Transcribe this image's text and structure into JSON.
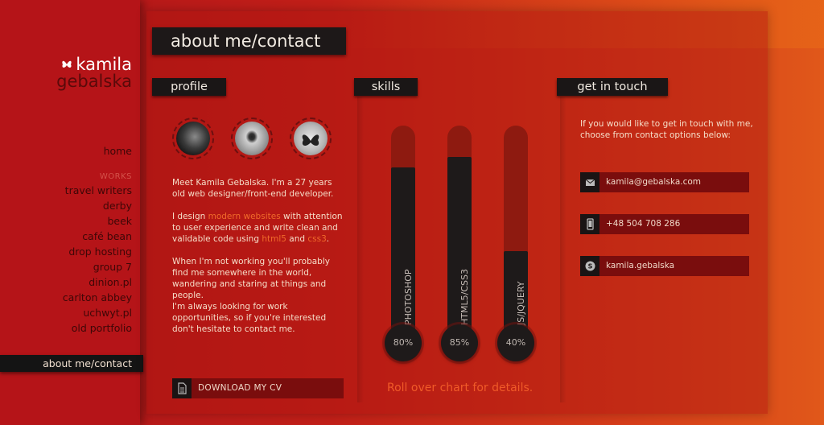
{
  "logo": {
    "line1": "kamila",
    "line2": "gebalska"
  },
  "nav": {
    "home": "home",
    "works_heading": "WORKS",
    "items": [
      "travel writers",
      "derby",
      "beek",
      "café bean",
      "drop hosting",
      "group 7",
      "dinion.pl",
      "carlton abbey",
      "uchwyt.pl",
      "old portfolio"
    ],
    "active": "about me/contact"
  },
  "page_title": "about me/contact",
  "profile": {
    "heading": "profile",
    "p1": "Meet Kamila Gebalska. I'm a 27 years old web designer/front-end developer.",
    "p2_pre": "I design ",
    "p2_link1": "modern websites",
    "p2_mid": " with attention to user experience and write clean and validable code using ",
    "p2_link2": "html5",
    "p2_and": " and ",
    "p2_link3": "css3",
    "p2_end": ".",
    "p3": "When I'm not working you'll probably find me somewhere in the world, wandering and staring at things and people.",
    "p4": "I'm always looking for work opportunities, so if you're interested don't hesitate to contact me.",
    "cv_button": "DOWNLOAD MY CV"
  },
  "skills": {
    "heading": "skills",
    "bars": [
      {
        "label": "PHOTOSHOP",
        "percent": "80%",
        "level": 0.8
      },
      {
        "label": "HTML5/CSS3",
        "percent": "85%",
        "level": 0.85
      },
      {
        "label": "JS/JQUERY",
        "percent": "40%",
        "level": 0.4
      }
    ],
    "hint": "Roll over chart for details."
  },
  "contact": {
    "heading": "get in touch",
    "intro": "If you would like to get in touch with me, choose from contact options below:",
    "email": "kamila@gebalska.com",
    "phone": "+48 504 708 286",
    "skype": "kamila.gebalska"
  },
  "icons": {
    "logo": "butterfly-icon",
    "cv": "document-icon",
    "email": "envelope-icon",
    "phone": "phone-icon",
    "skype": "skype-icon"
  }
}
